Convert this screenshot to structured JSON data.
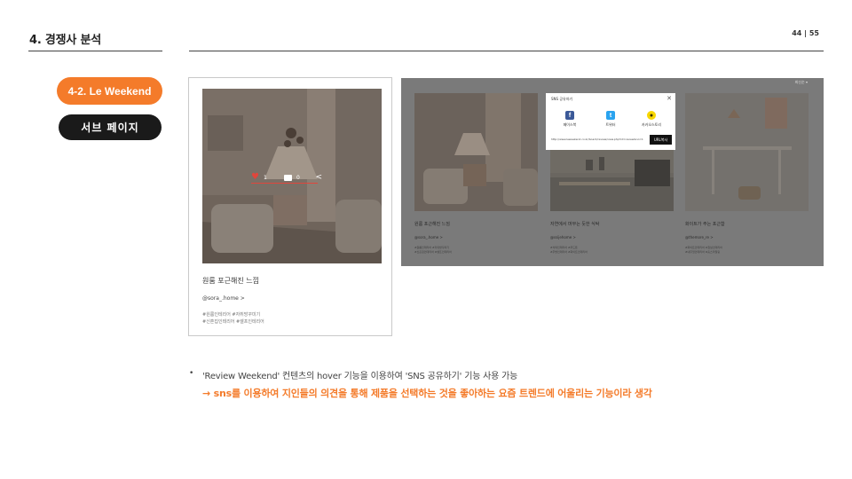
{
  "header": {
    "section_title": "4. 경쟁사 분석",
    "page_current": "44",
    "page_separator": "|",
    "page_total": "55"
  },
  "labels": {
    "brand_pill": "4-2. Le Weekend",
    "sub_page_pill": "서브 페이지"
  },
  "card": {
    "like_count": "1",
    "comment_count": "0",
    "title": "원룸 포근해진 느낌",
    "user": "@sora_.home  >",
    "tags_line1": "#원룸인테리어 #자취방꾸미기",
    "tags_line2": "#신혼집인테리어 #셀프인테리어"
  },
  "screenshot": {
    "sort_label": "최신순  ▾",
    "items": [
      {
        "title": "원룸 포근해진 느낌",
        "user": "@sora_.home  >",
        "tag1": "#원룸인테리어 #자취방꾸미기",
        "tag2": "#신혼집인테리어 #셀프인테리어"
      },
      {
        "title": "자연에서 머무는 듯한 식탁",
        "user": "@ssijehome  >",
        "tag1": "#식탁인테리어 #우드톤",
        "tag2": "#주방인테리어 #화이트인테리어"
      },
      {
        "title": "화이트가 주는 포근함",
        "user": "@themore_re  >",
        "tag1": "#화이트인테리어 #침실인테리어",
        "tag2": "#내추럴인테리어 #홈스타일링"
      }
    ],
    "modal": {
      "title": "SNS 공유하기",
      "close": "✕",
      "facebook_label": "페이스북",
      "twitter_label": "트위터",
      "kakao_label": "카카오스토리",
      "url": "http://www.leweekend.co.kr/board/review/view.php?id=review&no=1",
      "copy_label": "URL복사"
    }
  },
  "notes": {
    "bullet_symbol": "•",
    "bullet": "'Review Weekend' 컨텐츠의 hover 기능을 이용하여 'SNS 공유하기' 기능 사용 가능",
    "conclusion": "→ sns를 이용하여 지인들의 의견을 통해 제품을 선택하는 것을 좋아하는 요즘 트렌드에 어울리는 기능이라 생각"
  },
  "icons": [
    "heart-icon",
    "comment-icon",
    "share-icon",
    "facebook-icon",
    "twitter-icon",
    "kakaostory-icon",
    "close-icon"
  ],
  "colors": {
    "accent_orange": "#f47b2a",
    "dark_pill": "#1a1a1a",
    "overlay_gray": "#7a7a7a",
    "heart_red": "#e0463c"
  }
}
